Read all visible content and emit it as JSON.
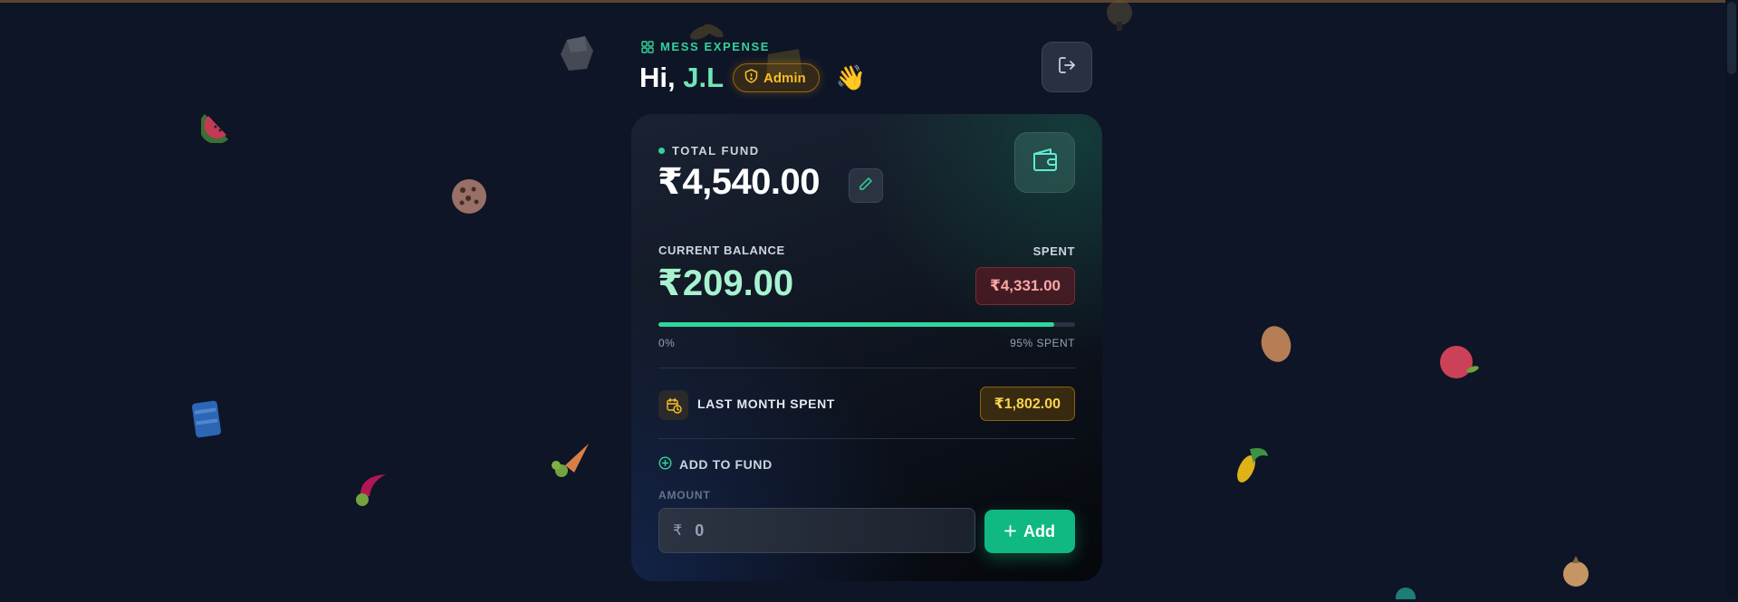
{
  "app": {
    "label": "MESS EXPENSE"
  },
  "header": {
    "greeting": "Hi,",
    "user_name": "J.L",
    "role_badge": "Admin",
    "wave": "👋"
  },
  "fund": {
    "total_label": "TOTAL FUND",
    "total_amount": "₹4,540.00",
    "current_balance_label": "CURRENT BALANCE",
    "current_balance": "₹209.00",
    "spent_label": "SPENT",
    "spent_amount": "₹4,331.00",
    "progress_percent": 95,
    "progress_left_label": "0%",
    "progress_right_label": "95% SPENT",
    "last_month_label": "LAST MONTH SPENT",
    "last_month_amount": "₹1,802.00"
  },
  "add_fund": {
    "title": "ADD TO FUND",
    "amount_label": "AMOUNT",
    "currency_symbol": "₹",
    "placeholder": "0",
    "value": "",
    "button_label": "Add"
  },
  "background_icons": [
    "rock",
    "sprout",
    "mushroom",
    "watermelon",
    "cookie",
    "cube",
    "potato",
    "apple",
    "can",
    "carrot",
    "radish",
    "corn",
    "onion"
  ],
  "colors": {
    "background": "#0e1526",
    "accent": "#10b981",
    "accent_light": "#6ee7b7",
    "warning": "#fbbf24",
    "danger": "#fca5a5"
  }
}
